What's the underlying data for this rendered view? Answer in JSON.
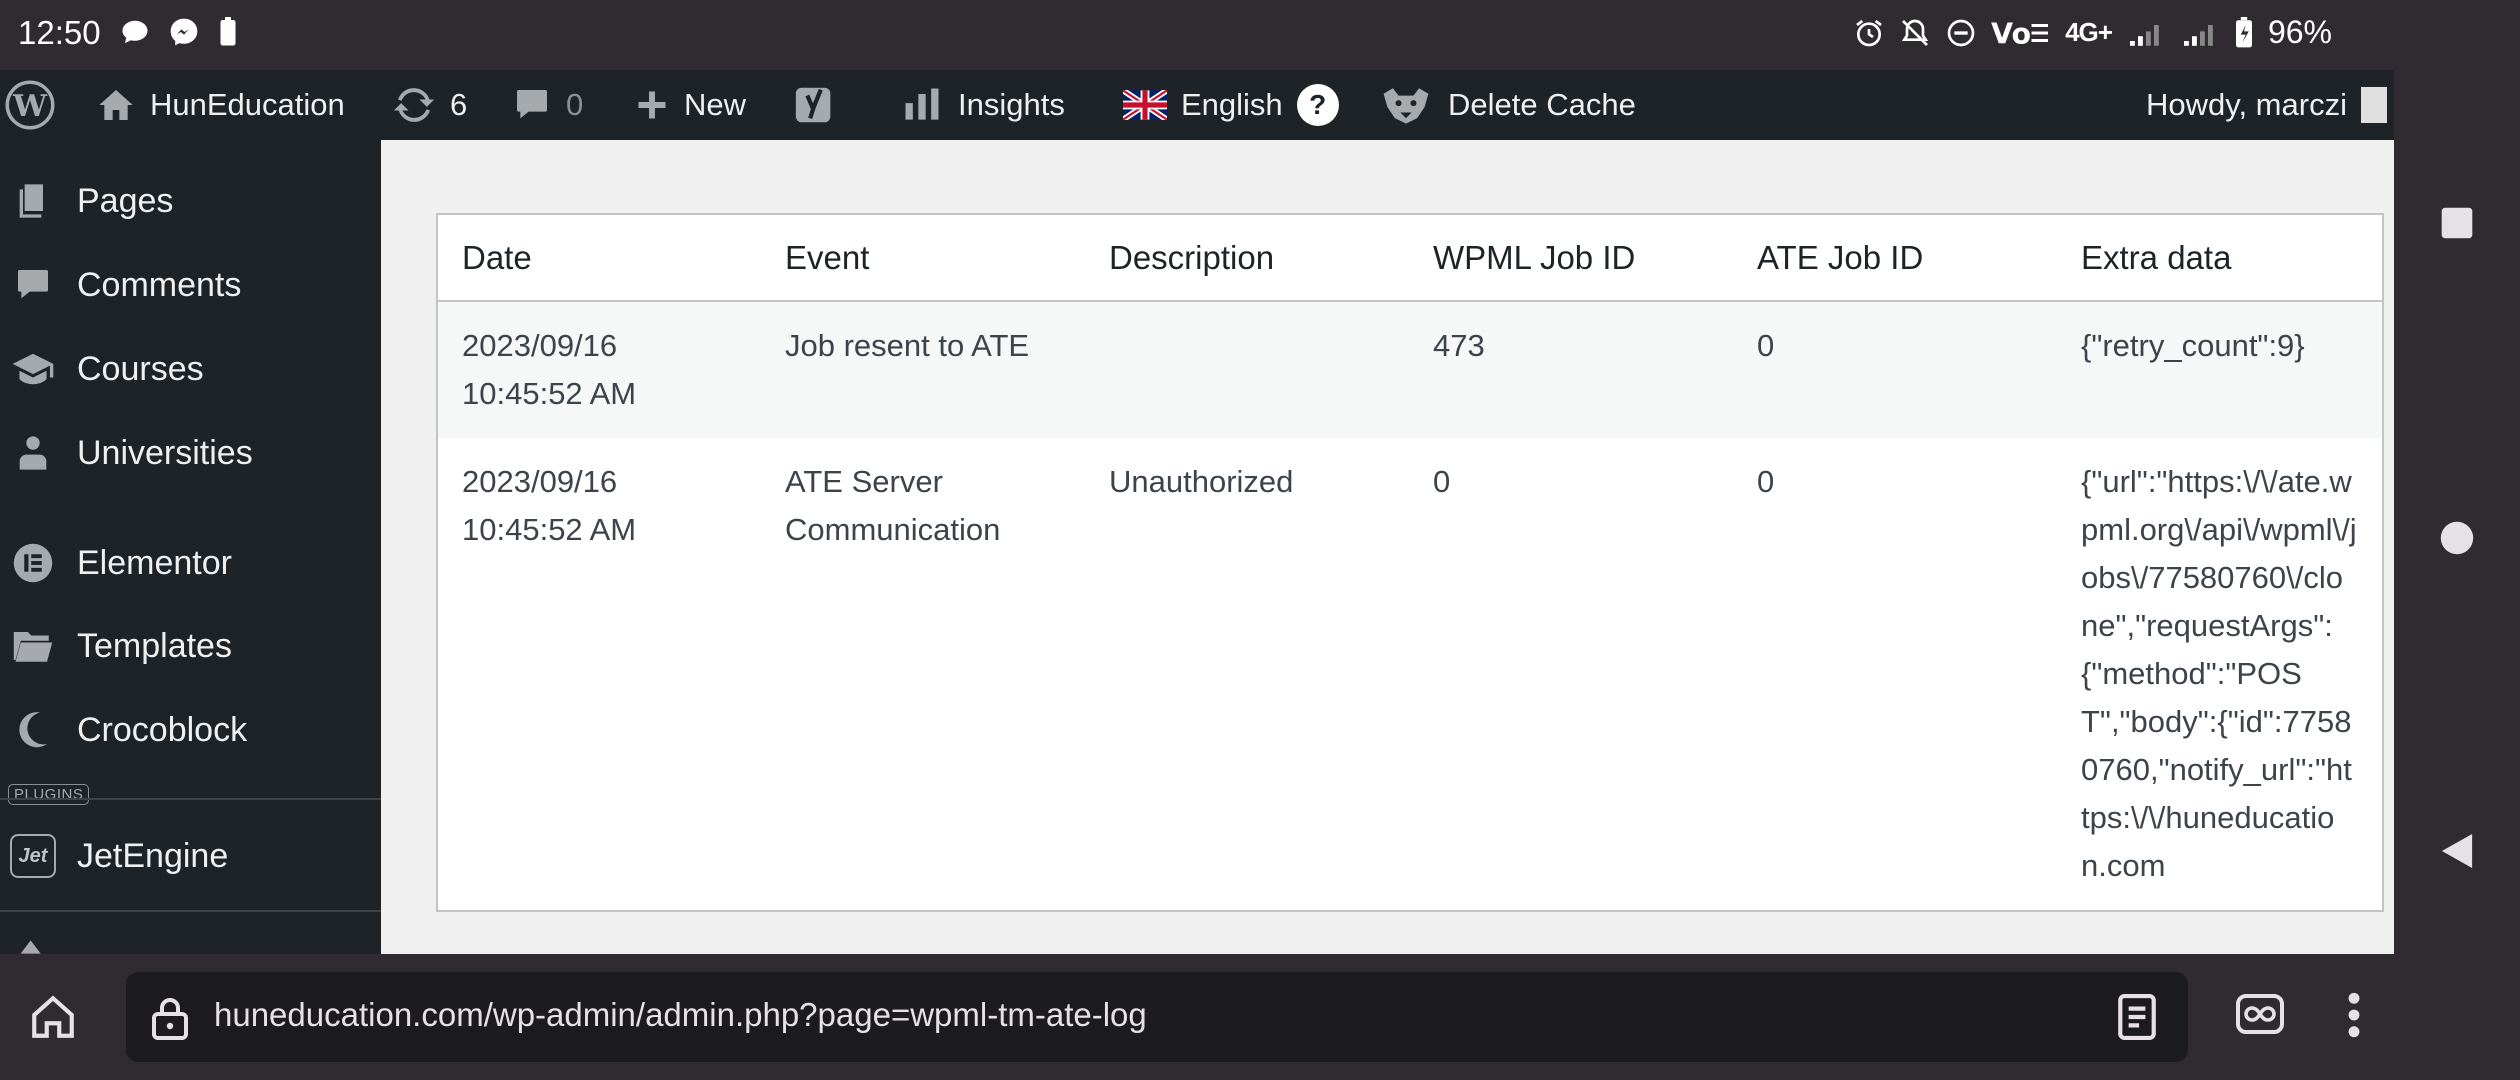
{
  "status_bar": {
    "time": "12:50",
    "network": "4G+",
    "battery": "96%"
  },
  "admin_bar": {
    "site_name": "HunEducation",
    "updates_count": "6",
    "comments_count": "0",
    "new_label": "New",
    "insights_label": "Insights",
    "language_label": "English",
    "help_label": "?",
    "delete_cache_label": "Delete Cache",
    "howdy_label": "Howdy, marczi"
  },
  "sidebar": {
    "items": [
      {
        "label": "Pages",
        "icon": "pages-icon"
      },
      {
        "label": "Comments",
        "icon": "comments-icon"
      },
      {
        "label": "Courses",
        "icon": "courses-icon"
      },
      {
        "label": "Universities",
        "icon": "universities-icon"
      },
      {
        "label": "Elementor",
        "icon": "elementor-icon"
      },
      {
        "label": "Templates",
        "icon": "templates-icon"
      },
      {
        "label": "Crocoblock",
        "icon": "crocoblock-icon"
      },
      {
        "label": "JetEngine",
        "icon": "jetengine-icon"
      }
    ],
    "plugins_tag": "PLUGINS",
    "jet_icon_text": "Jet"
  },
  "log_table": {
    "columns": [
      "Date",
      "Event",
      "Description",
      "WPML Job ID",
      "ATE Job ID",
      "Extra data"
    ],
    "rows": [
      {
        "date": "2023/09/16 10:45:52 AM",
        "event": "Job resent to ATE",
        "description": "",
        "wpml_job_id": "473",
        "ate_job_id": "0",
        "extra": "{\"retry_count\":9}"
      },
      {
        "date": "2023/09/16 10:45:52 AM",
        "event": "ATE Server Communication",
        "description": "Unauthorized",
        "wpml_job_id": "0",
        "ate_job_id": "0",
        "extra": "{\"url\":\"https:\\/\\/ate.wpml.org\\/api\\/wpml\\/jobs\\/77580760\\/clone\",\"requestArgs\":{\"method\":\"POST\",\"body\":{\"id\":77580760,\"notify_url\":\"https:\\/\\/huneducation.com"
      }
    ]
  },
  "browser": {
    "url": "huneducation.com/wp-admin/admin.php?page=wpml-tm-ate-log"
  },
  "colors": {
    "admin_bar_bg": "#1d2327",
    "content_bg": "#f0f0f1",
    "system_bar_bg": "#2f2b30"
  }
}
